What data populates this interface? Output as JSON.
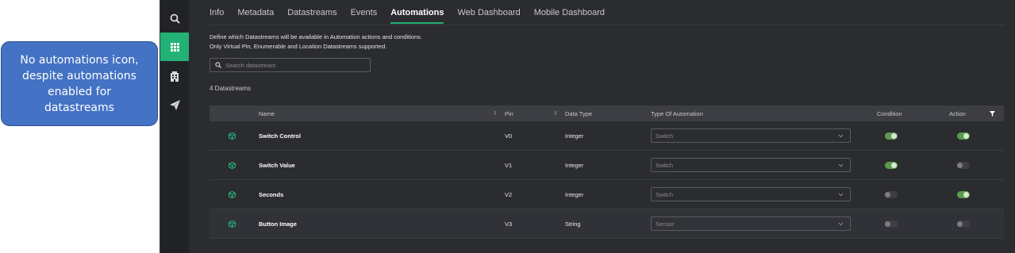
{
  "callout": {
    "text": "No automations icon, despite automations enabled for datastreams"
  },
  "iconbar": {
    "items": [
      {
        "name": "search-icon",
        "active": false
      },
      {
        "name": "grid-icon",
        "active": true
      },
      {
        "name": "building-icon",
        "active": false
      },
      {
        "name": "send-icon",
        "active": false
      }
    ]
  },
  "tabs": [
    {
      "label": "Info",
      "active": false
    },
    {
      "label": "Metadata",
      "active": false
    },
    {
      "label": "Datastreams",
      "active": false
    },
    {
      "label": "Events",
      "active": false
    },
    {
      "label": "Automations",
      "active": true
    },
    {
      "label": "Web Dashboard",
      "active": false
    },
    {
      "label": "Mobile Dashboard",
      "active": false
    }
  ],
  "description": {
    "line1": "Define which Datastreams will be available in Automation actions and conditions.",
    "line2": "Only Virtual Pin, Enumerable and Location Datastreams supported."
  },
  "search": {
    "placeholder": "Search datastream"
  },
  "count": "4 Datastreams",
  "table": {
    "headers": {
      "name": "Name",
      "pin": "Pin",
      "data_type": "Data Type",
      "type_of_automation": "Type Of Automation",
      "condition": "Condition",
      "action": "Action"
    },
    "rows": [
      {
        "name": "Switch Control",
        "pin": "V0",
        "data_type": "Integer",
        "automation": "Switch",
        "condition": true,
        "action": true
      },
      {
        "name": "Switch Value",
        "pin": "V1",
        "data_type": "Integer",
        "automation": "Switch",
        "condition": true,
        "action": false
      },
      {
        "name": "Seconds",
        "pin": "V2",
        "data_type": "Integer",
        "automation": "Switch",
        "condition": false,
        "action": true
      },
      {
        "name": "Button Image",
        "pin": "V3",
        "data_type": "String",
        "automation": "Sensor",
        "condition": false,
        "action": false
      }
    ]
  },
  "colors": {
    "accent": "#23b176",
    "toggle_on": "#5c9b4c",
    "background": "#2b2c30",
    "callout": "#4472c4"
  }
}
